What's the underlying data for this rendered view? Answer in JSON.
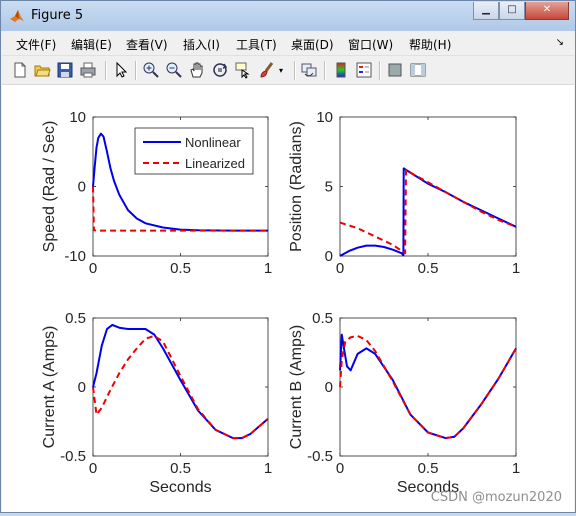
{
  "window": {
    "title": "Figure 5"
  },
  "window_buttons": {
    "minimize": "▁",
    "maximize": "□",
    "close": "✕"
  },
  "menu": [
    {
      "label": "文件(F)"
    },
    {
      "label": "编辑(E)"
    },
    {
      "label": "查看(V)"
    },
    {
      "label": "插入(I)"
    },
    {
      "label": "工具(T)"
    },
    {
      "label": "桌面(D)"
    },
    {
      "label": "窗口(W)"
    },
    {
      "label": "帮助(H)"
    }
  ],
  "toolbar_icons": [
    "new-figure-icon",
    "open-file-icon",
    "save-icon",
    "print-icon",
    "edit-plot-arrow-icon",
    "zoom-in-icon",
    "zoom-out-icon",
    "pan-hand-icon",
    "rotate-3d-icon",
    "data-cursor-icon",
    "brush-icon",
    "link-plot-icon",
    "colorbar-icon",
    "legend-icon",
    "hide-plot-tools-icon",
    "show-plot-tools-icon"
  ],
  "colors": {
    "nonlinear": "#0000ee",
    "linearized": "#ee0000"
  },
  "watermark": "CSDN @mozun2020",
  "chart_data": [
    {
      "type": "line",
      "ylabel": "Speed (Rad / Sec)",
      "xlabel": "",
      "xlim": [
        0,
        1
      ],
      "ylim": [
        -10,
        10
      ],
      "xticks": [
        "0",
        "0.5",
        "1"
      ],
      "yticks": [
        "-10",
        "0",
        "10"
      ],
      "legend": {
        "position": "top-right",
        "entries": [
          "Nonlinear",
          "Linearized"
        ]
      },
      "series": [
        {
          "name": "Nonlinear",
          "style": "solid",
          "points": [
            [
              0,
              0
            ],
            [
              0.01,
              3
            ],
            [
              0.02,
              5.6
            ],
            [
              0.03,
              7.0
            ],
            [
              0.045,
              7.6
            ],
            [
              0.06,
              7.2
            ],
            [
              0.08,
              5.0
            ],
            [
              0.1,
              2.6
            ],
            [
              0.12,
              0.8
            ],
            [
              0.15,
              -1.2
            ],
            [
              0.2,
              -3.4
            ],
            [
              0.25,
              -4.6
            ],
            [
              0.3,
              -5.3
            ],
            [
              0.4,
              -5.9
            ],
            [
              0.5,
              -6.2
            ],
            [
              0.6,
              -6.3
            ],
            [
              0.8,
              -6.35
            ],
            [
              1.0,
              -6.35
            ]
          ]
        },
        {
          "name": "Linearized",
          "style": "dashed",
          "points": [
            [
              0,
              0
            ],
            [
              0.005,
              -6.3
            ],
            [
              0.02,
              -6.35
            ],
            [
              1.0,
              -6.35
            ]
          ]
        }
      ]
    },
    {
      "type": "line",
      "ylabel": "Position (Radians)",
      "xlabel": "",
      "xlim": [
        0,
        1
      ],
      "ylim": [
        0,
        10
      ],
      "xticks": [
        "0",
        "0.5",
        "1"
      ],
      "yticks": [
        "0",
        "5",
        "10"
      ],
      "series": [
        {
          "name": "Nonlinear",
          "style": "solid",
          "points": [
            [
              0,
              0
            ],
            [
              0.05,
              0.35
            ],
            [
              0.1,
              0.6
            ],
            [
              0.15,
              0.75
            ],
            [
              0.2,
              0.75
            ],
            [
              0.25,
              0.65
            ],
            [
              0.3,
              0.45
            ],
            [
              0.35,
              0.2
            ],
            [
              0.36,
              0.05
            ],
            [
              0.362,
              6.3
            ],
            [
              0.4,
              6.0
            ],
            [
              0.5,
              5.2
            ],
            [
              0.6,
              4.6
            ],
            [
              0.7,
              3.9
            ],
            [
              0.8,
              3.3
            ],
            [
              0.9,
              2.7
            ],
            [
              1.0,
              2.1
            ]
          ]
        },
        {
          "name": "Linearized",
          "style": "dashed",
          "points": [
            [
              0,
              2.4
            ],
            [
              0.1,
              2.0
            ],
            [
              0.2,
              1.4
            ],
            [
              0.3,
              0.8
            ],
            [
              0.37,
              0.2
            ],
            [
              0.375,
              6.2
            ],
            [
              0.4,
              6.0
            ],
            [
              0.5,
              5.3
            ],
            [
              0.6,
              4.6
            ],
            [
              0.7,
              3.9
            ],
            [
              0.8,
              3.2
            ],
            [
              0.9,
              2.6
            ],
            [
              1.0,
              2.1
            ]
          ]
        }
      ]
    },
    {
      "type": "line",
      "ylabel": "Current A (Amps)",
      "xlabel": "Seconds",
      "xlim": [
        0,
        1
      ],
      "ylim": [
        -0.5,
        0.5
      ],
      "xticks": [
        "0",
        "0.5",
        "1"
      ],
      "yticks": [
        "-0.5",
        "0",
        "0.5"
      ],
      "series": [
        {
          "name": "Nonlinear",
          "style": "solid",
          "points": [
            [
              0,
              0
            ],
            [
              0.02,
              0.1
            ],
            [
              0.05,
              0.3
            ],
            [
              0.08,
              0.42
            ],
            [
              0.11,
              0.45
            ],
            [
              0.15,
              0.43
            ],
            [
              0.2,
              0.42
            ],
            [
              0.3,
              0.42
            ],
            [
              0.35,
              0.38
            ],
            [
              0.4,
              0.28
            ],
            [
              0.5,
              0.05
            ],
            [
              0.6,
              -0.17
            ],
            [
              0.7,
              -0.31
            ],
            [
              0.8,
              -0.37
            ],
            [
              0.85,
              -0.37
            ],
            [
              0.9,
              -0.34
            ],
            [
              1.0,
              -0.23
            ]
          ]
        },
        {
          "name": "Linearized",
          "style": "dashed",
          "points": [
            [
              0,
              0
            ],
            [
              0.02,
              -0.2
            ],
            [
              0.05,
              -0.15
            ],
            [
              0.1,
              -0.02
            ],
            [
              0.15,
              0.1
            ],
            [
              0.2,
              0.2
            ],
            [
              0.25,
              0.28
            ],
            [
              0.3,
              0.35
            ],
            [
              0.35,
              0.37
            ],
            [
              0.4,
              0.33
            ],
            [
              0.5,
              0.08
            ],
            [
              0.6,
              -0.16
            ],
            [
              0.7,
              -0.31
            ],
            [
              0.8,
              -0.37
            ],
            [
              0.85,
              -0.37
            ],
            [
              0.9,
              -0.34
            ],
            [
              1.0,
              -0.23
            ]
          ]
        }
      ]
    },
    {
      "type": "line",
      "ylabel": "Current B (Amps)",
      "xlabel": "Seconds",
      "xlim": [
        0,
        1
      ],
      "ylim": [
        -0.5,
        0.5
      ],
      "xticks": [
        "0",
        "0.5",
        "1"
      ],
      "yticks": [
        "-0.5",
        "0",
        "0.5"
      ],
      "series": [
        {
          "name": "Nonlinear",
          "style": "solid",
          "points": [
            [
              0,
              0.12
            ],
            [
              0.01,
              0.38
            ],
            [
              0.02,
              0.3
            ],
            [
              0.04,
              0.15
            ],
            [
              0.06,
              0.12
            ],
            [
              0.08,
              0.18
            ],
            [
              0.1,
              0.24
            ],
            [
              0.15,
              0.28
            ],
            [
              0.2,
              0.24
            ],
            [
              0.3,
              0.05
            ],
            [
              0.4,
              -0.2
            ],
            [
              0.5,
              -0.33
            ],
            [
              0.6,
              -0.37
            ],
            [
              0.65,
              -0.36
            ],
            [
              0.7,
              -0.3
            ],
            [
              0.8,
              -0.13
            ],
            [
              0.9,
              0.06
            ],
            [
              1.0,
              0.28
            ]
          ]
        },
        {
          "name": "Linearized",
          "style": "dashed",
          "points": [
            [
              0,
              0
            ],
            [
              0.01,
              0.2
            ],
            [
              0.03,
              0.33
            ],
            [
              0.06,
              0.36
            ],
            [
              0.1,
              0.37
            ],
            [
              0.15,
              0.34
            ],
            [
              0.2,
              0.26
            ],
            [
              0.3,
              0.04
            ],
            [
              0.4,
              -0.2
            ],
            [
              0.5,
              -0.33
            ],
            [
              0.6,
              -0.37
            ],
            [
              0.65,
              -0.36
            ],
            [
              0.7,
              -0.3
            ],
            [
              0.8,
              -0.13
            ],
            [
              0.9,
              0.06
            ],
            [
              1.0,
              0.28
            ]
          ]
        }
      ]
    }
  ]
}
